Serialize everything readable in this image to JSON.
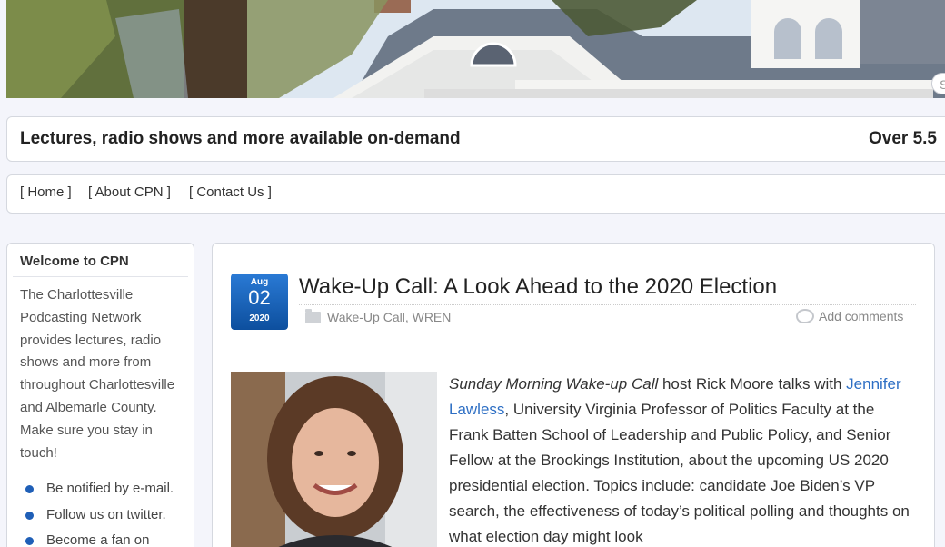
{
  "header": {
    "search_placeholder": "Search..."
  },
  "tagline": {
    "left": "Lectures, radio shows and more available on-demand",
    "right": "Over 5.5"
  },
  "nav": {
    "items": [
      {
        "label": "[ Home ]"
      },
      {
        "label": "[ About CPN ]"
      },
      {
        "label": "[ Contact Us ]"
      }
    ]
  },
  "sidebar": {
    "title": "Welcome to CPN",
    "description": "The Charlottesville Podcasting Network provides lectures, radio shows and more from throughout Charlottesville and Albemarle County. Make sure you stay in touch!",
    "links": [
      {
        "label": "Be notified by e-mail."
      },
      {
        "label": "Follow us on twitter."
      },
      {
        "label": "Become a fan on"
      }
    ]
  },
  "article": {
    "date": {
      "month": "Aug",
      "day": "02",
      "year": "2020"
    },
    "title": "Wake-Up Call: A Look Ahead to the 2020 Election",
    "categories": "Wake-Up Call, WREN",
    "comments_label": "Add comments",
    "body": {
      "show_name": "Sunday Morning Wake-up Call",
      "intro": " host Rick Moore talks with ",
      "guest_link": "Jennifer Lawless",
      "rest": ", University Virginia Professor of Politics Faculty at the Frank Batten School of Leadership and Public Policy, and Senior Fellow at the Brookings Institution, about the upcoming US 2020 presidential election. Topics include: candidate Joe Biden’s VP search, the effectiveness of today’s political polling and thoughts on what election day might look"
    }
  },
  "colors": {
    "accent": "#1f5fb7",
    "link": "#2e6fc4",
    "badge_top": "#2a7ad5",
    "badge_bottom": "#0d4f9e"
  }
}
